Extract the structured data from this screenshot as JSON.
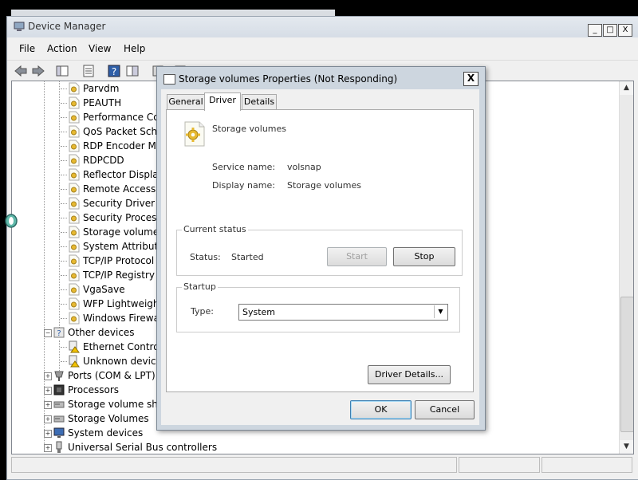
{
  "device_manager": {
    "title": "Device Manager",
    "window_buttons": {
      "minimize": "_",
      "maximize": "□",
      "close": "X"
    },
    "menu": [
      "File",
      "Action",
      "View",
      "Help"
    ],
    "tree": {
      "system_devices_children": [
        "Parvdm",
        "PEAUTH",
        "Performance Cour",
        "QoS Packet Sched",
        "RDP Encoder Mirr",
        "RDPCDD",
        "Reflector Display",
        "Remote Access IP",
        "Security Driver",
        "Security Processo",
        "Storage volumes",
        "System Attribute",
        "TCP/IP Protocol D",
        "TCP/IP Registry Co",
        "VgaSave",
        "WFP Lightweight",
        "Windows Firewall"
      ],
      "other_devices": {
        "label": "Other devices",
        "children": [
          "Ethernet Controlle",
          "Unknown device"
        ]
      },
      "categories": [
        "Ports (COM & LPT)",
        "Processors",
        "Storage volume shad",
        "Storage Volumes",
        "System devices",
        "Universal Serial Bus controllers"
      ]
    }
  },
  "dialog": {
    "title": "Storage volumes Properties (Not Responding)",
    "close": "X",
    "tabs": [
      "General",
      "Driver",
      "Details"
    ],
    "active_tab": "Driver",
    "driver_name": "Storage volumes",
    "service_name_label": "Service name:",
    "service_name_value": "volsnap",
    "display_name_label": "Display name:",
    "display_name_value": "Storage volumes",
    "current_status": {
      "legend": "Current status",
      "status_label": "Status:",
      "status_value": "Started",
      "start_label": "Start",
      "stop_label": "Stop"
    },
    "startup": {
      "legend": "Startup",
      "type_label": "Type:",
      "type_value": "System"
    },
    "driver_details_label": "Driver Details...",
    "ok_label": "OK",
    "cancel_label": "Cancel"
  },
  "colors": {
    "accent_blue": "#3c7fb1",
    "warning_yellow": "#f2c200",
    "dialog_frame": "#cdd6df"
  }
}
